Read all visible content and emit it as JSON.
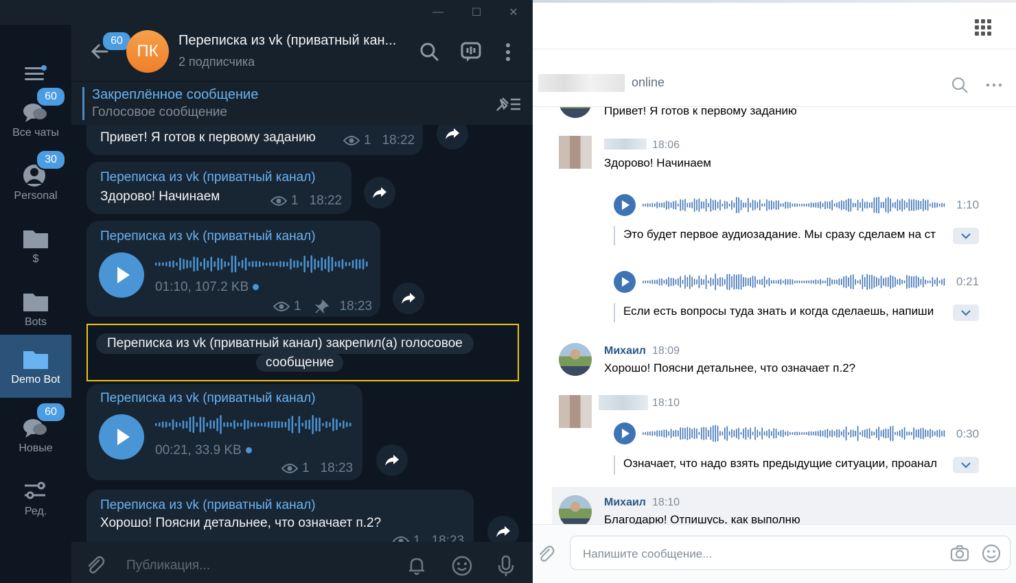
{
  "telegram": {
    "window": {
      "minimize": "—",
      "maximize": "☐",
      "close": "✕"
    },
    "folders": [
      {
        "label": "",
        "icon": "menu-icon"
      },
      {
        "label": "Все чаты",
        "badge": "60",
        "icon": "chat-bubbles-icon"
      },
      {
        "label": "Personal",
        "badge": "30",
        "icon": "person-icon"
      },
      {
        "label": "$",
        "icon": "folder-icon"
      },
      {
        "label": "Bots",
        "icon": "folder-icon"
      },
      {
        "label": "Demo Bot",
        "icon": "folder-icon",
        "active": true
      },
      {
        "label": "Новые",
        "badge": "60",
        "icon": "chat-bubbles-icon"
      },
      {
        "label": "Ред.",
        "icon": "sliders-icon"
      }
    ],
    "header": {
      "back_badge": "60",
      "avatar_initials": "ПК",
      "title": "Переписка из vk (приватный кан...",
      "subtitle": "2 подписчика"
    },
    "pinned": {
      "title": "Закреплённое сообщение",
      "text": "Голосовое сообщение"
    },
    "messages": [
      {
        "text": "Привет! Я готов к первому заданию",
        "views": "1",
        "time": "18:22"
      },
      {
        "sender": "Переписка из vk (приватный канал)",
        "text": "Здорово! Начинаем",
        "views": "1",
        "time": "18:22"
      },
      {
        "sender": "Переписка из vk (приватный канал)",
        "voice_info": "01:10, 107.2 KB",
        "views": "1",
        "time": "18:23",
        "pinned": true
      },
      {
        "service_line1": "Переписка из vk (приватный канал) закрепил(а) голосовое",
        "service_line2": "сообщение"
      },
      {
        "sender": "Переписка из vk (приватный канал)",
        "voice_info": "00:21, 33.9 KB",
        "views": "1",
        "time": "18:23"
      },
      {
        "sender": "Переписка из vk (приватный канал)",
        "text": "Хорошо! Поясни детальнее, что означает п.2?",
        "views": "1",
        "time": "18:23"
      }
    ],
    "compose": {
      "placeholder": "Публикация..."
    }
  },
  "vk": {
    "header": {
      "status": "online"
    },
    "messages": [
      {
        "text": "Привет! Я готов к первому заданию"
      },
      {
        "time": "18:06",
        "text": "Здорово! Начинаем"
      },
      {
        "duration": "1:10",
        "transcript": "Это будет первое аудиозадание. Мы сразу сделаем на ст"
      },
      {
        "duration": "0:21",
        "transcript": "Если есть вопросы туда знать и когда сделаешь, напиши"
      },
      {
        "name": "Михаил",
        "time": "18:09",
        "text": "Хорошо! Поясни детальнее, что означает п.2?"
      },
      {
        "time": "18:10",
        "duration": "0:30",
        "transcript": "Означает, что надо взять предыдущие ситуации, проанал"
      },
      {
        "name": "Михаил",
        "time": "18:10",
        "text": "Благодарю! Отпишусь, как выполню"
      }
    ],
    "compose": {
      "placeholder": "Напишите сообщение..."
    }
  }
}
